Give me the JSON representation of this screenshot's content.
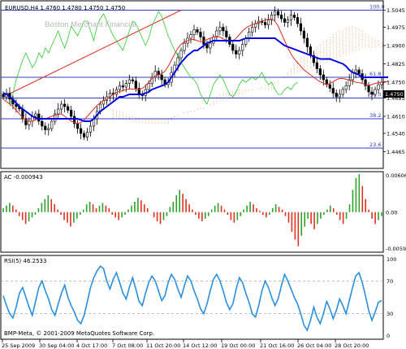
{
  "chart_data": [
    {
      "type": "candlestick",
      "title": "EURUSD,H4  1.4760  1.4780  1.4750  1.4750",
      "watermark": "Boston Merchant Financial",
      "ylim": [
        1.44,
        1.508
      ],
      "yticks": [
        "1.5045",
        "1.4975",
        "1.4900",
        "1.4825",
        "1.4750",
        "1.4685",
        "1.4610",
        "1.4540",
        "1.4465"
      ],
      "ytick_values": [
        1.5045,
        1.4975,
        1.49,
        1.4825,
        1.475,
        1.4685,
        1.461,
        1.454,
        1.4465
      ],
      "current_price_label": "1.4750",
      "fib_levels": [
        {
          "label": "100.0",
          "price": 1.5045
        },
        {
          "label": "61.8",
          "price": 1.477
        },
        {
          "label": "50.0",
          "price": 1.4685
        },
        {
          "label": "38.2",
          "price": 1.46
        },
        {
          "label": "23.6",
          "price": 1.448
        }
      ],
      "trendline": {
        "start_price": 1.469,
        "end_price": 1.5045,
        "color": "#e03020"
      },
      "series_colors": {
        "kijun": "#0000e0",
        "tenkan": "#e03020",
        "chikou": "#2ecc2e",
        "cloud": "#e8b088",
        "cloud_dark": "#a0a0b8",
        "candles": "#000000"
      },
      "candles_ohlc_note": "",
      "close": [
        1.469,
        1.4705,
        1.468,
        1.466,
        1.465,
        1.464,
        1.46,
        1.4575,
        1.459,
        1.461,
        1.462,
        1.459,
        1.457,
        1.4555,
        1.456,
        1.459,
        1.462,
        1.464,
        1.466,
        1.465,
        1.4635,
        1.461,
        1.458,
        1.456,
        1.454,
        1.4525,
        1.4545,
        1.457,
        1.46,
        1.463,
        1.466,
        1.4675,
        1.469,
        1.4705,
        1.47,
        1.472,
        1.4735,
        1.473,
        1.4745,
        1.476,
        1.4755,
        1.4725,
        1.47,
        1.4695,
        1.472,
        1.4745,
        1.477,
        1.4795,
        1.478,
        1.476,
        1.474,
        1.475,
        1.479,
        1.482,
        1.485,
        1.488,
        1.491,
        1.493,
        1.4945,
        1.4965,
        1.4955,
        1.4935,
        1.4905,
        1.489,
        1.491,
        1.4935,
        1.496,
        1.4975,
        1.496,
        1.4935,
        1.4905,
        1.488,
        1.4865,
        1.488,
        1.4905,
        1.493,
        1.4955,
        1.4975,
        1.499,
        1.5,
        1.4995,
        1.4985,
        1.5005,
        1.5025,
        1.504,
        1.5025,
        1.501,
        1.4995,
        1.5005,
        1.5025,
        1.5015,
        1.499,
        1.496,
        1.493,
        1.4895,
        1.486,
        1.483,
        1.4805,
        1.478,
        1.476,
        1.474,
        1.4725,
        1.4705,
        1.469,
        1.47,
        1.472,
        1.4735,
        1.476,
        1.479,
        1.48,
        1.4785,
        1.476,
        1.4735,
        1.471,
        1.47,
        1.472,
        1.474,
        1.475
      ],
      "tenkan": [
        1.468,
        1.467,
        1.466,
        1.465,
        1.4635,
        1.462,
        1.4605,
        1.4595,
        1.459,
        1.459,
        1.4595,
        1.46,
        1.4598,
        1.46,
        1.4605,
        1.461,
        1.4615,
        1.4618,
        1.462,
        1.461,
        1.46,
        1.459,
        1.4585,
        1.458,
        1.4585,
        1.4595,
        1.461,
        1.4625,
        1.464,
        1.4655,
        1.4665,
        1.4675,
        1.468,
        1.469,
        1.47,
        1.4708,
        1.4712,
        1.4715,
        1.472,
        1.4722,
        1.4722,
        1.472,
        1.472,
        1.4725,
        1.4735,
        1.475,
        1.4765,
        1.4775,
        1.478,
        1.4785,
        1.4795,
        1.4815,
        1.484,
        1.4865,
        1.489,
        1.4905,
        1.4915,
        1.492,
        1.4925,
        1.4925,
        1.492,
        1.4915,
        1.4918,
        1.4925,
        1.493,
        1.4935,
        1.4938,
        1.4935,
        1.4928,
        1.492,
        1.4918,
        1.492,
        1.493,
        1.4945,
        1.496,
        1.4972,
        1.498,
        1.4985,
        1.499,
        1.4995,
        1.5,
        1.5005,
        1.5008,
        1.5008,
        1.5,
        1.498,
        1.495,
        1.492,
        1.489,
        1.4865,
        1.4845,
        1.483,
        1.4815,
        1.48,
        1.479,
        1.478,
        1.477,
        1.476,
        1.4752,
        1.4745,
        1.474,
        1.4745,
        1.4752,
        1.476,
        1.4765,
        1.4765,
        1.4762,
        1.4758,
        1.4755,
        1.475,
        1.4748,
        1.4745,
        1.474,
        1.4738,
        1.474,
        1.4745,
        1.4748,
        1.475,
        1.4752,
        1.4752
      ],
      "kijun": [
        1.4705,
        1.47,
        1.469,
        1.468,
        1.4665,
        1.465,
        1.464,
        1.463,
        1.462,
        1.461,
        1.4605,
        1.46,
        1.46,
        1.46,
        1.46,
        1.46,
        1.46,
        1.46,
        1.46,
        1.46,
        1.46,
        1.46,
        1.46,
        1.46,
        1.4595,
        1.459,
        1.459,
        1.459,
        1.46,
        1.4615,
        1.463,
        1.464,
        1.465,
        1.466,
        1.467,
        1.468,
        1.469,
        1.469,
        1.4695,
        1.47,
        1.47,
        1.47,
        1.47,
        1.47,
        1.4705,
        1.471,
        1.472,
        1.4725,
        1.473,
        1.4735,
        1.474,
        1.475,
        1.477,
        1.479,
        1.481,
        1.483,
        1.4845,
        1.486,
        1.487,
        1.488,
        1.488,
        1.489,
        1.49,
        1.491,
        1.4915,
        1.492,
        1.492,
        1.492,
        1.492,
        1.492,
        1.492,
        1.492,
        1.492,
        1.492,
        1.4925,
        1.493,
        1.493,
        1.493,
        1.493,
        1.493,
        1.493,
        1.493,
        1.493,
        1.493,
        1.493,
        1.492,
        1.491,
        1.49,
        1.4895,
        1.489,
        1.4885,
        1.488,
        1.4875,
        1.487,
        1.4865,
        1.486,
        1.4855,
        1.485,
        1.4845,
        1.4845,
        1.4845,
        1.4845,
        1.484,
        1.4835,
        1.483,
        1.4825,
        1.4815,
        1.48,
        1.479,
        1.4785,
        1.478,
        1.477,
        1.477,
        1.477,
        1.477,
        1.477,
        1.477,
        1.477,
        1.477,
        1.477
      ],
      "cloud_top": [
        1.464,
        1.4635,
        1.463,
        1.4625,
        1.462,
        1.4615,
        1.461,
        1.4608,
        1.4605,
        1.4603,
        1.46,
        1.46,
        1.46,
        1.46,
        1.46,
        1.46,
        1.46,
        1.46,
        1.4605,
        1.461,
        1.4615,
        1.462,
        1.462,
        1.462,
        1.4625,
        1.463,
        1.464,
        1.4645,
        1.4645,
        1.4645,
        1.466,
        1.4675,
        1.469,
        1.47,
        1.4705,
        1.471,
        1.4715,
        1.4715,
        1.4715,
        1.472,
        1.472,
        1.472,
        1.472,
        1.472,
        1.472,
        1.472,
        1.472,
        1.472,
        1.472,
        1.4725,
        1.4735,
        1.4745,
        1.476,
        1.477,
        1.479,
        1.4805,
        1.482,
        1.4835,
        1.485,
        1.486,
        1.487,
        1.488,
        1.4885,
        1.4895,
        1.4905,
        1.4915,
        1.4925,
        1.4935,
        1.4945,
        1.4955,
        1.496,
        1.4965,
        1.497,
        1.4975,
        1.498,
        1.4975,
        1.497,
        1.496,
        1.495,
        1.494,
        1.4935,
        1.493,
        1.492,
        1.491
      ],
      "cloud_bottom": [
        1.46,
        1.4598,
        1.4596,
        1.4594,
        1.4592,
        1.459,
        1.4588,
        1.4586,
        1.4584,
        1.4582,
        1.458,
        1.458,
        1.458,
        1.458,
        1.458,
        1.458,
        1.458,
        1.458,
        1.459,
        1.46,
        1.461,
        1.462,
        1.4625,
        1.463,
        1.4632,
        1.4634,
        1.4636,
        1.4638,
        1.464,
        1.4645,
        1.465,
        1.4655,
        1.466,
        1.4665,
        1.467,
        1.4675,
        1.468,
        1.4685,
        1.469,
        1.4695,
        1.47,
        1.4705,
        1.471,
        1.4715,
        1.472,
        1.4725,
        1.473,
        1.4735,
        1.474,
        1.4745,
        1.475,
        1.4755,
        1.476,
        1.4765,
        1.477,
        1.4775,
        1.478,
        1.4785,
        1.479,
        1.4795,
        1.48,
        1.4805,
        1.481,
        1.4815,
        1.482,
        1.4825,
        1.483,
        1.4835,
        1.484,
        1.4845,
        1.485,
        1.4855,
        1.486,
        1.4865,
        1.487,
        1.4875,
        1.488,
        1.4885,
        1.489,
        1.489,
        1.489,
        1.489,
        1.489,
        1.489
      ],
      "chikou": [
        1.465,
        1.47,
        1.476,
        1.48,
        1.484,
        1.487,
        1.484,
        1.481,
        1.483,
        1.487,
        1.485,
        1.489,
        1.487,
        1.49,
        1.493,
        1.496,
        1.492,
        1.489,
        1.493,
        1.498,
        1.496,
        1.494,
        1.497,
        1.5,
        1.5,
        1.496,
        1.492,
        1.498,
        1.501,
        1.503,
        1.5,
        1.497,
        1.494,
        1.492,
        1.49,
        1.488,
        1.492,
        1.496,
        1.5,
        1.499,
        1.496,
        1.493,
        1.49,
        1.493,
        1.498,
        1.501,
        1.504,
        1.502,
        1.498,
        1.494,
        1.491,
        1.488,
        1.486,
        1.483,
        1.481,
        1.479,
        1.477,
        1.476,
        1.474,
        1.47,
        1.468,
        1.466,
        1.47,
        1.474,
        1.476,
        1.478,
        1.476,
        1.473,
        1.47,
        1.469,
        1.471,
        1.474,
        1.476,
        1.475,
        1.476,
        1.477,
        1.476,
        1.477,
        1.479,
        1.476,
        1.474,
        1.475,
        1.472,
        1.47,
        1.47,
        1.472,
        1.473,
        1.472,
        1.474,
        1.475
      ],
      "legend": ""
    },
    {
      "type": "bar",
      "title": "AC -0.000943",
      "ylim": [
        -0.00599,
        0.006064
      ],
      "yticks": [
        "0.006064",
        "0.00",
        "-0.00599"
      ],
      "ytick_values": [
        0.006064,
        0.0,
        -0.00599
      ],
      "up_color": "#2ea02e",
      "down_color": "#e03020",
      "values": [
        0.0006,
        0.001,
        0.0014,
        0.001,
        0.0004,
        -0.0006,
        -0.0012,
        -0.0018,
        -0.0014,
        -0.0008,
        -0.0004,
        0.0006,
        0.0014,
        0.002,
        0.0026,
        0.002,
        0.0012,
        0.0004,
        -0.0004,
        -0.0012,
        -0.0016,
        -0.0022,
        -0.0016,
        -0.001,
        -0.0004,
        0.0004,
        0.0012,
        0.0016,
        0.0012,
        0.0006,
        0.001,
        0.0014,
        0.001,
        0.0006,
        -0.0004,
        -0.0008,
        -0.0012,
        -0.0008,
        -0.0004,
        0.0004,
        0.001,
        0.0016,
        0.0022,
        0.0018,
        0.0012,
        0.0006,
        0.0,
        -0.0008,
        -0.0014,
        -0.0018,
        -0.0012,
        -0.0006,
        0.0008,
        0.0016,
        0.0026,
        0.0034,
        0.0028,
        0.002,
        0.0012,
        0.0004,
        -0.0004,
        -0.001,
        -0.0014,
        -0.001,
        -0.0006,
        0.0004,
        0.001,
        0.0014,
        0.001,
        0.0004,
        -0.0004,
        -0.0012,
        -0.0016,
        -0.0012,
        -0.0006,
        0.0004,
        0.001,
        0.0016,
        0.0012,
        0.0006,
        0.0002,
        -0.0004,
        -0.0008,
        -0.0004,
        0.0006,
        0.0012,
        0.0008,
        0.0004,
        -0.0006,
        -0.0016,
        -0.003,
        -0.0042,
        -0.0052,
        -0.0036,
        -0.0022,
        -0.001,
        -0.0018,
        -0.0026,
        -0.0018,
        -0.001,
        -0.0004,
        0.0004,
        0.001,
        0.0006,
        -0.0004,
        -0.0012,
        -0.0018,
        -0.001,
        0.0012,
        0.0034,
        0.0052,
        0.0058,
        0.004,
        0.002,
        0.0004,
        -0.001,
        -0.0018,
        -0.0012,
        -0.0006
      ],
      "legend": ""
    },
    {
      "type": "line",
      "title": "RSI(5) 46.2533",
      "ylim": [
        0,
        100
      ],
      "yticks": [
        "100",
        "70",
        "30",
        "0"
      ],
      "ytick_values": [
        100,
        70,
        30,
        0
      ],
      "color": "#2a8fe0",
      "values": [
        52,
        40,
        30,
        25,
        38,
        55,
        62,
        50,
        38,
        28,
        45,
        62,
        70,
        58,
        48,
        35,
        28,
        42,
        55,
        65,
        50,
        40,
        32,
        22,
        18,
        28,
        45,
        62,
        74,
        82,
        88,
        85,
        70,
        60,
        72,
        80,
        68,
        55,
        48,
        62,
        74,
        60,
        45,
        40,
        55,
        68,
        76,
        70,
        58,
        46,
        52,
        68,
        78,
        72,
        60,
        50,
        64,
        76,
        70,
        58,
        48,
        36,
        30,
        42,
        58,
        72,
        78,
        70,
        58,
        44,
        35,
        42,
        60,
        74,
        68,
        55,
        44,
        30,
        26,
        40,
        58,
        70,
        62,
        50,
        40,
        48,
        64,
        78,
        70,
        60,
        50,
        42,
        30,
        16,
        10,
        22,
        38,
        26,
        18,
        30,
        45,
        36,
        24,
        34,
        48,
        40,
        30,
        46,
        62,
        76,
        80,
        68,
        52,
        34,
        22,
        32,
        44,
        46
      ],
      "legend": ""
    }
  ],
  "x_axis": {
    "labels": [
      "25 Sep 2009",
      "30 Sep 04:00",
      "4 Oct 17:00",
      "7 Oct 08:00",
      "11 Oct 20:00",
      "14 Oct 12:00",
      "19 Oct 00:00",
      "21 Oct 16:00",
      "26 Oct 04:00",
      "28 Oct 20:00"
    ]
  },
  "footer": "BMP-Meta, © 2001-2009 MetaQuotes Software Corp."
}
